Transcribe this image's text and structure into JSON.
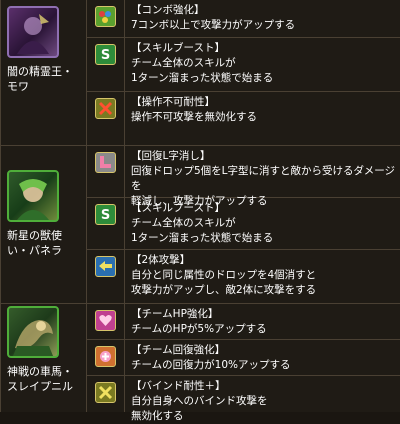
{
  "groups": [
    {
      "monster": "闇の精霊王・モワ",
      "awakenings": [
        {
          "icon": "combo-boost-icon",
          "title": "【コンボ強化】",
          "desc": [
            "7コンボ以上で攻撃力がアップする"
          ]
        },
        {
          "icon": "skill-boost-icon",
          "title": "【スキルブースト】",
          "desc": [
            "チーム全体のスキルが",
            "1ターン溜まった状態で始まる"
          ]
        },
        {
          "icon": "no-control-resist-icon",
          "title": "【操作不可耐性】",
          "desc": [
            "操作不可攻撃を無効化する"
          ]
        }
      ]
    },
    {
      "monster": "新星の獣使い・パネラ",
      "awakenings": [
        {
          "icon": "l-shape-heal-icon",
          "title": "【回復L字消し】",
          "desc": [
            "回復ドロップ5個をL字型に消すと敵から受けるダメージを",
            "軽減し、攻撃力がアップする"
          ]
        },
        {
          "icon": "skill-boost-icon",
          "title": "【スキルブースト】",
          "desc": [
            "チーム全体のスキルが",
            "1ターン溜まった状態で始まる"
          ]
        },
        {
          "icon": "two-way-attack-icon",
          "title": "【2体攻撃】",
          "desc": [
            "自分と同じ属性のドロップを4個消すと",
            "攻撃力がアップし、敵2体に攻撃をする"
          ]
        }
      ]
    },
    {
      "monster": "神戦の車馬・スレイプニル",
      "awakenings": [
        {
          "icon": "team-hp-icon",
          "title": "【チームHP強化】",
          "desc": [
            "チームのHPが5%アップする"
          ]
        },
        {
          "icon": "team-rcv-icon",
          "title": "【チーム回復強化】",
          "desc": [
            "チームの回復力が10%アップする"
          ]
        },
        {
          "icon": "bind-resist-plus-icon",
          "title": "【バインド耐性＋】",
          "desc": [
            "自分自身へのバインド攻撃を",
            "無効化する"
          ]
        }
      ]
    }
  ]
}
